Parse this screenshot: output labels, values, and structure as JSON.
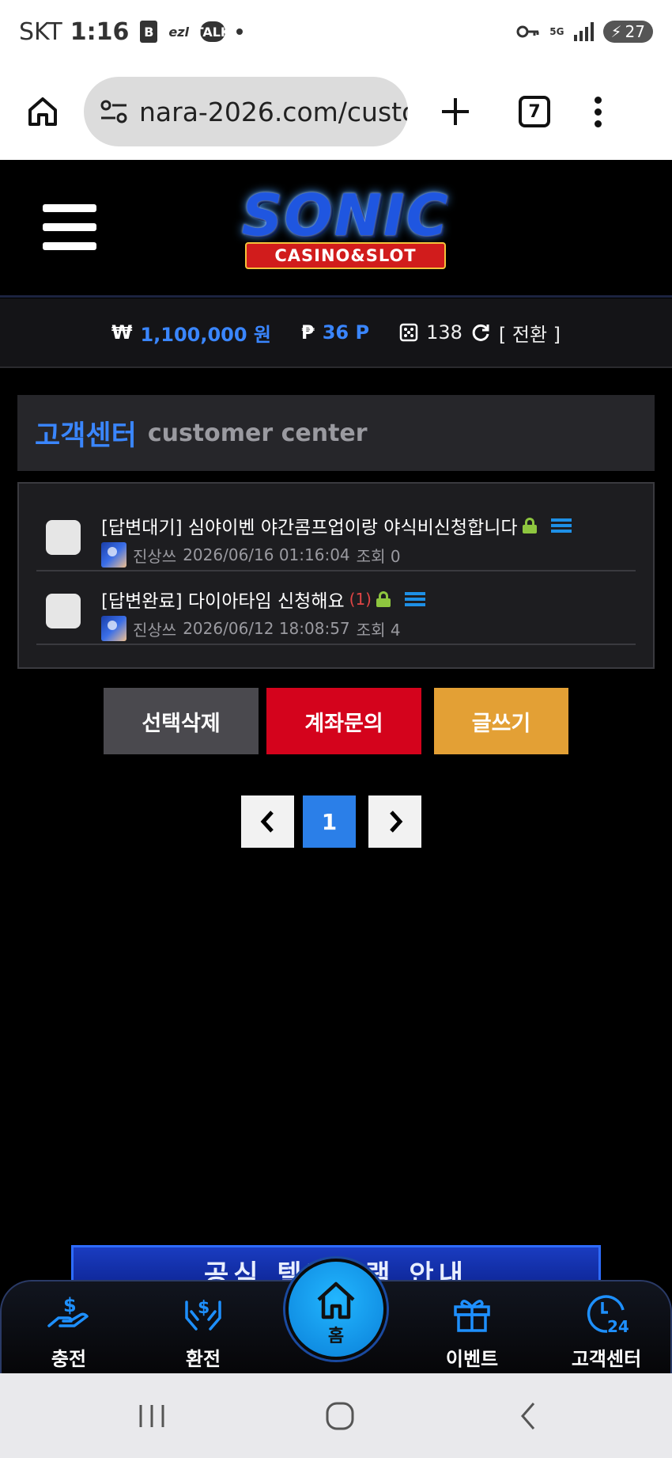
{
  "status_bar": {
    "carrier": "SKT",
    "time": "1:16",
    "app_icons": [
      "B",
      "ezl",
      "TALK"
    ],
    "network": "5G",
    "battery": "27"
  },
  "browser": {
    "url": "nara-2026.com/custo",
    "tab_count": "7"
  },
  "site": {
    "logo_main": "SONIC",
    "logo_sub": "CASINO&SLOT"
  },
  "balance": {
    "won_symbol": "₩",
    "won_value": "1,100,000 원",
    "point_symbol": "₱",
    "point_value": "36 P",
    "ticket_value": "138",
    "switch_label": "[ 전환 ]"
  },
  "panel": {
    "title_ko": "고객센터",
    "title_en": "customer center"
  },
  "posts": [
    {
      "title": "[답변대기] 심야이벤 야간콤프업이랑 야식비신청합니다",
      "comment_count": "",
      "author": "진상쓰",
      "datetime": "2026/06/16 01:16:04",
      "views": "조회 0"
    },
    {
      "title": "[답변완료] 다이아타임 신청해요",
      "comment_count": "(1)",
      "author": "진상쓰",
      "datetime": "2026/06/12 18:08:57",
      "views": "조회 4"
    }
  ],
  "actions": {
    "delete_selected": "선택삭제",
    "account_inquiry": "계좌문의",
    "write": "글쓰기"
  },
  "pagination": {
    "prev": "‹",
    "current": "1",
    "next": "›"
  },
  "banner": {
    "text": "공식 텔레그램 안내"
  },
  "bottom_nav": {
    "charge": "충전",
    "exchange": "환전",
    "home": "홈",
    "event": "이벤트",
    "support": "고객센터"
  },
  "colors": {
    "accent_blue": "#3a86ff",
    "delete_btn": "#4a494e",
    "account_btn": "#d4031c",
    "write_btn": "#e3a035",
    "nav_icon_blue": "#1e90ff"
  }
}
